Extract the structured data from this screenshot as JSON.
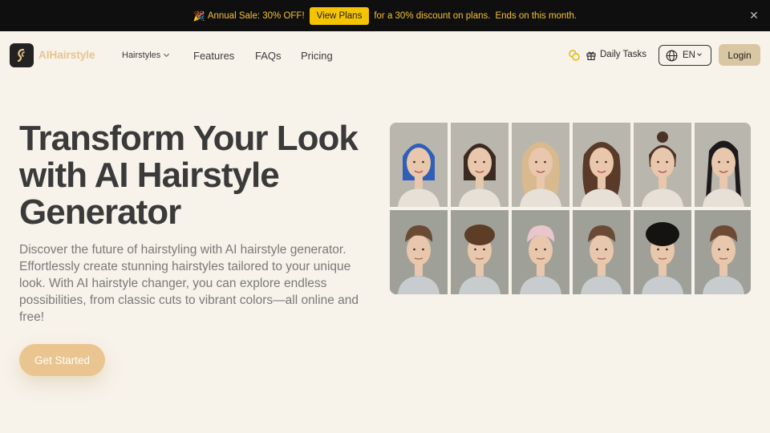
{
  "promo": {
    "party_icon": "party-popper-icon",
    "sale_text": "Annual Sale: 30% OFF!",
    "button_label": "View Plans",
    "description": "for a 30% discount on plans.",
    "ends_text": "Ends on this month.",
    "close_icon": "close-icon"
  },
  "nav": {
    "brand": "AIHairstyle",
    "links": [
      "Hairstyles",
      "Features",
      "FAQs",
      "Pricing"
    ],
    "daily_tasks": "Daily Tasks",
    "language": "EN",
    "login": "Login"
  },
  "hero": {
    "title": "Transform Your Look with AI Hairstyle Generator",
    "description": "Discover the future of hairstyling with AI hairstyle generator. Effortlessly create stunning hairstyles tailored to your unique look. With AI hairstyle changer, you can explore endless possibilities, from classic cuts to vibrant colors—all online and free!",
    "cta": "Get Started"
  },
  "gallery": {
    "women": [
      {
        "hair": "blue bob",
        "color": "#2f5fb8"
      },
      {
        "hair": "brown shoulder bob",
        "color": "#3b2a22"
      },
      {
        "hair": "blonde curls",
        "color": "#d9b98e"
      },
      {
        "hair": "brown voluminous curls",
        "color": "#5a3a28"
      },
      {
        "hair": "top bun",
        "color": "#4a3226"
      },
      {
        "hair": "black braids",
        "color": "#1c1a1a"
      }
    ],
    "men": [
      {
        "hair": "short brown",
        "color": "#6b4a33"
      },
      {
        "hair": "brown curls",
        "color": "#5d3d25"
      },
      {
        "hair": "pink textured",
        "color": "#e8c6cc"
      },
      {
        "hair": "short fringe",
        "color": "#6a4a34"
      },
      {
        "hair": "black afro",
        "color": "#151312"
      },
      {
        "hair": "pompadour",
        "color": "#6e4a32"
      }
    ]
  }
}
